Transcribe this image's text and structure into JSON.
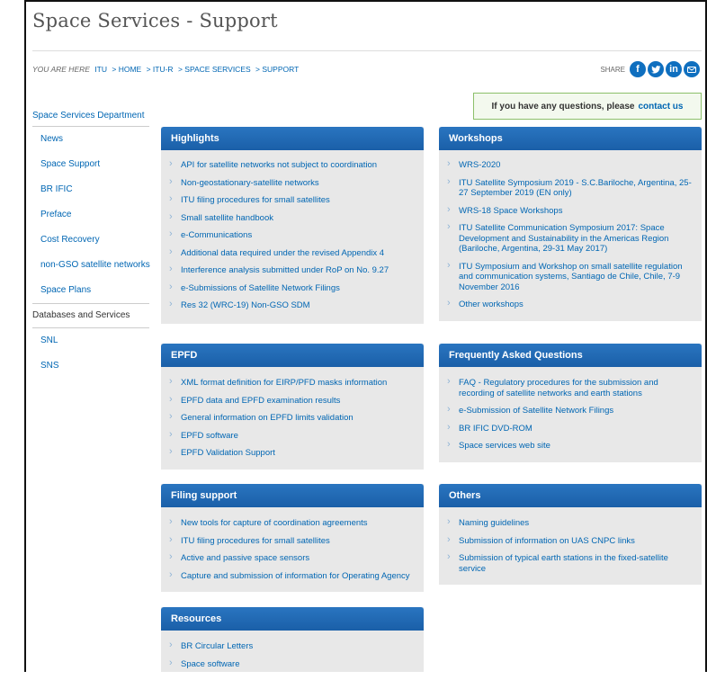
{
  "page": {
    "title": "Space Services - Support"
  },
  "breadcrumb": {
    "label": "YOU ARE HERE",
    "items": [
      "ITU",
      "> HOME",
      "> ITU-R",
      "> SPACE SERVICES",
      "> SUPPORT"
    ]
  },
  "share": {
    "label": "SHARE",
    "icons": [
      "facebook-icon",
      "twitter-icon",
      "linkedin-icon",
      "email-icon"
    ]
  },
  "contact": {
    "text": "If you have any questions, please",
    "link": "contact us"
  },
  "sidebar": {
    "heading": "Space Services Department",
    "items": [
      "News",
      "Space Support",
      "BR IFIC",
      "Preface",
      "Cost Recovery",
      "non-GSO satellite networks",
      "Space Plans"
    ],
    "section": "Databases and Services",
    "section_items": [
      "SNL",
      "SNS"
    ]
  },
  "boxes": {
    "highlights": {
      "title": "Highlights",
      "items": [
        "API for satellite networks not subject to coordination",
        "Non-geostationary-satellite networks",
        "ITU filing procedures for small satellites",
        "Small satellite handbook",
        "e-Communications",
        "Additional data required under the revised Appendix 4",
        "Interference analysis submitted under RoP on No. 9.27",
        "e-Submissions of Satellite Network Filings",
        "Res 32 (WRC-19) Non-GSO SDM"
      ]
    },
    "workshops": {
      "title": "Workshops",
      "items": [
        "WRS-2020",
        "ITU Satellite Symposium 2019 - S.C.Bariloche, Argentina, 25-27 September 2019 (EN only)",
        "WRS-18 Space Workshops",
        "ITU Satellite Communication Symposium 2017: Space Development and Sustainability in the Americas Region (Bariloche, Argentina, 29-31 May 2017)",
        "ITU Symposium and Workshop on small satellite regulation and communication systems, Santiago de Chile, Chile, 7-9 November 2016",
        "Other workshops"
      ]
    },
    "epfd": {
      "title": "EPFD",
      "items": [
        "XML format definition for EIRP/PFD masks information",
        "EPFD data and EPFD examination results",
        "General information on EPFD limits validation",
        "EPFD software",
        "EPFD Validation Support"
      ]
    },
    "faq": {
      "title": "Frequently Asked Questions",
      "items": [
        "FAQ - Regulatory procedures for the submission and recording of satellite networks and earth stations",
        "e-Submission of Satellite Network Filings",
        "BR IFIC DVD-ROM",
        "Space services web site"
      ]
    },
    "filing": {
      "title": "Filing support",
      "items": [
        "New tools for capture of coordination agreements",
        "ITU filing procedures for small satellites",
        "Active and passive space sensors",
        "Capture and submission of information for Operating Agency"
      ]
    },
    "others": {
      "title": "Others",
      "items": [
        "Naming guidelines",
        "Submission of information on UAS CNPC links",
        "Submission of typical earth stations in the fixed-satellite service"
      ]
    },
    "resources": {
      "title": "Resources",
      "items": [
        "BR Circular Letters",
        "Space software"
      ]
    }
  }
}
